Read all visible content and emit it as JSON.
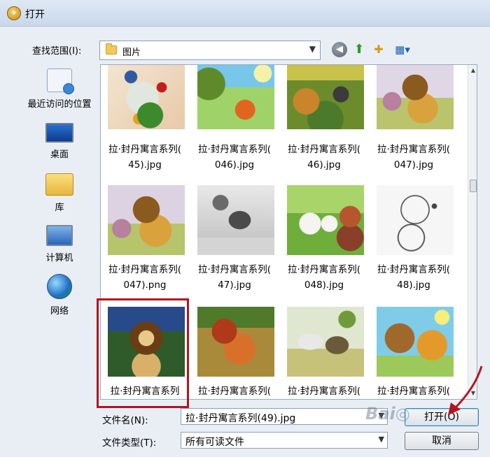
{
  "window": {
    "title": "打开"
  },
  "toolbar": {
    "look_in_label": "查找范围(I):",
    "look_in_value": "图片",
    "icons": [
      "back-icon",
      "up-folder-icon",
      "new-folder-icon",
      "view-menu-icon"
    ]
  },
  "places": [
    {
      "label": "最近访问的位置",
      "icon": "recent-places-icon"
    },
    {
      "label": "桌面",
      "icon": "desktop-icon"
    },
    {
      "label": "库",
      "icon": "libraries-icon"
    },
    {
      "label": "计算机",
      "icon": "computer-icon"
    },
    {
      "label": "网络",
      "icon": "network-icon"
    }
  ],
  "files": [
    {
      "line1": "拉·封丹寓言系列(",
      "line2": "45).jpg"
    },
    {
      "line1": "拉·封丹寓言系列(",
      "line2": "046).jpg"
    },
    {
      "line1": "拉·封丹寓言系列(",
      "line2": "46).jpg"
    },
    {
      "line1": "拉·封丹寓言系列(",
      "line2": "047).jpg"
    },
    {
      "line1": "拉·封丹寓言系列(",
      "line2": "047).png"
    },
    {
      "line1": "拉·封丹寓言系列(",
      "line2": "47).jpg"
    },
    {
      "line1": "拉·封丹寓言系列(",
      "line2": "048).jpg"
    },
    {
      "line1": "拉·封丹寓言系列(",
      "line2": "48).jpg"
    },
    {
      "line1": "拉·封丹寓言系列",
      "line2": ""
    },
    {
      "line1": "拉·封丹寓言系列(",
      "line2": ""
    },
    {
      "line1": "拉·封丹寓言系列(",
      "line2": ""
    },
    {
      "line1": "拉·封丹寓言系列(",
      "line2": ""
    }
  ],
  "selected_index": 8,
  "footer": {
    "filename_label": "文件名(N):",
    "filename_value": "拉·封丹寓言系列(49).jpg",
    "filetype_label": "文件类型(T):",
    "filetype_value": "所有可读文件",
    "open_button": "打开(O)",
    "cancel_button": "取消"
  },
  "colors": {
    "selection_border": "#b2161e",
    "annotation_arrow": "#b2161e"
  }
}
